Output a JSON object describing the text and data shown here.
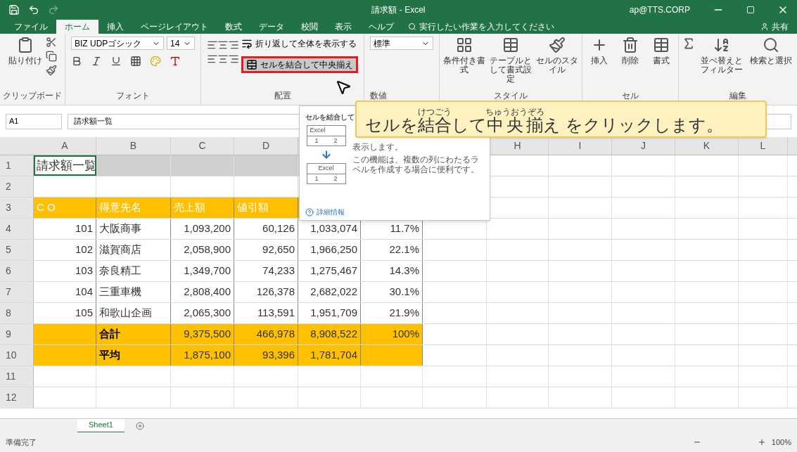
{
  "window": {
    "title": "請求額 - Excel",
    "account": "ap@TTS.CORP"
  },
  "ribbon_tabs": [
    {
      "label": "ファイル",
      "selected": false
    },
    {
      "label": "ホーム",
      "selected": true
    },
    {
      "label": "挿入",
      "selected": false
    },
    {
      "label": "ページレイアウト",
      "selected": false
    },
    {
      "label": "数式",
      "selected": false
    },
    {
      "label": "データ",
      "selected": false
    },
    {
      "label": "校閲",
      "selected": false
    },
    {
      "label": "表示",
      "selected": false
    },
    {
      "label": "ヘルプ",
      "selected": false
    }
  ],
  "tell_me": {
    "placeholder": "実行したい作業を入力してください"
  },
  "share": "共有",
  "clipboard": {
    "paste": "貼り付け",
    "label": "クリップボード"
  },
  "font": {
    "name": "BIZ UDPゴシック",
    "size": "14",
    "label": "フォント"
  },
  "alignment": {
    "wrap": "折り返して全体を表示する",
    "merge": {
      "label": "セルを結合して中央揃え",
      "highlighted": true
    },
    "label": "配置"
  },
  "number": {
    "format": "標準",
    "label": "数値"
  },
  "styles": {
    "buttons": [
      "条件付き書式",
      "テーブルとして書式設定",
      "セルのスタイル"
    ],
    "label": "スタイル"
  },
  "cells": {
    "buttons": [
      "挿入",
      "削除",
      "書式"
    ],
    "label": "セル"
  },
  "editing": {
    "buttons": [
      "並べ替えとフィルター",
      "検索と選択"
    ],
    "label": "編集"
  },
  "formula_bar": {
    "name_box": "A1",
    "formula": "請求額一覧"
  },
  "sheet": {
    "columns": [
      "A",
      "B",
      "C",
      "D",
      "H",
      "I",
      "J",
      "K",
      "L"
    ],
    "rows": [
      {
        "num": "1",
        "kind": "title",
        "cells": [
          "請求額一覧"
        ]
      },
      {
        "num": "2",
        "kind": "blank"
      },
      {
        "num": "3",
        "kind": "header",
        "cells": [
          "C O",
          "得意先名",
          "売上額",
          "値引額"
        ]
      },
      {
        "num": "4",
        "kind": "data",
        "cells": [
          "101",
          "大阪商事",
          "1,093,200",
          "60,126",
          "1,033,074",
          "11.7%"
        ]
      },
      {
        "num": "5",
        "kind": "data",
        "cells": [
          "102",
          "滋賀商店",
          "2,058,900",
          "92,650",
          "1,966,250",
          "22.1%"
        ]
      },
      {
        "num": "6",
        "kind": "data",
        "cells": [
          "103",
          "奈良精工",
          "1,349,700",
          "74,233",
          "1,275,467",
          "14.3%"
        ]
      },
      {
        "num": "7",
        "kind": "data",
        "cells": [
          "104",
          "三重車機",
          "2,808,400",
          "126,378",
          "2,682,022",
          "30.1%"
        ]
      },
      {
        "num": "8",
        "kind": "data",
        "cells": [
          "105",
          "和歌山企画",
          "2,065,300",
          "113,591",
          "1,951,709",
          "21.9%"
        ]
      },
      {
        "num": "9",
        "kind": "total",
        "cells": [
          "",
          "合計",
          "9,375,500",
          "466,978",
          "8,908,522",
          "100%"
        ]
      },
      {
        "num": "10",
        "kind": "total",
        "cells": [
          "",
          "平均",
          "1,875,100",
          "93,396",
          "1,781,704"
        ]
      },
      {
        "num": "11",
        "kind": "blank"
      },
      {
        "num": "12",
        "kind": "blank"
      }
    ]
  },
  "popup": {
    "title": "セルを結合して",
    "preview_before": [
      "Excel",
      "1",
      "2"
    ],
    "preview_after": [
      "Excel",
      "1",
      "2"
    ],
    "text": [
      "表示します。",
      "この機能は、複数の列にわたるラベルを作成する場合に便利です。"
    ],
    "link": "詳細情報"
  },
  "banner": {
    "segments": [
      {
        "text": "セルを"
      },
      {
        "text": "結合",
        "ruby": "けつごう"
      },
      {
        "text": "して"
      },
      {
        "text": "中央揃",
        "ruby": "ちゅうおうぞろ"
      },
      {
        "text": "え をクリックします。"
      }
    ]
  },
  "sheet_tabs": [
    {
      "label": "Sheet1",
      "selected": true
    }
  ],
  "status": {
    "text": "準備完了",
    "zoom": "100%"
  }
}
